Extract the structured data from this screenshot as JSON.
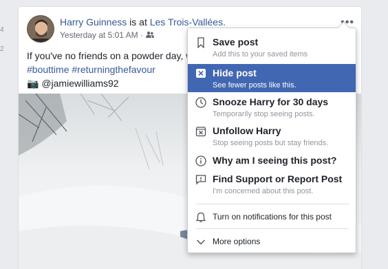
{
  "side_numbers": [
    "4",
    "2"
  ],
  "post": {
    "author": "Harry Guinness",
    "verb": "is at",
    "place": "Les Trois-Vallées.",
    "time": "Yesterday at 5:01 AM ·",
    "text_line1": "If you've no friends on a powder day, w",
    "hashtags": "#bouttime #returningthefavour",
    "camera_glyph": "📷",
    "credit": "@jamiewilliams92",
    "more_glyph": "•••"
  },
  "menu": {
    "selected_color": "#4267b2",
    "items": [
      {
        "title": "Save post",
        "subtitle": "Add this to your saved items",
        "icon": "bookmark-icon"
      },
      {
        "title": "Hide post",
        "subtitle": "See fewer posts like this.",
        "icon": "hide-x-icon"
      },
      {
        "title": "Snooze Harry for 30 days",
        "subtitle": "Temporarily stop seeing posts.",
        "icon": "clock-icon"
      },
      {
        "title": "Unfollow Harry",
        "subtitle": "Stop seeing posts but stay friends.",
        "icon": "unfollow-icon"
      },
      {
        "title": "Why am I seeing this post?",
        "subtitle": "",
        "icon": "info-icon"
      },
      {
        "title": "Find Support or Report Post",
        "subtitle": "I'm concerned about this post.",
        "icon": "report-icon"
      },
      {
        "title": "Turn on notifications for this post",
        "subtitle": "",
        "icon": "bell-icon"
      },
      {
        "title": "More options",
        "subtitle": "",
        "icon": "chevron-down-icon"
      }
    ]
  }
}
